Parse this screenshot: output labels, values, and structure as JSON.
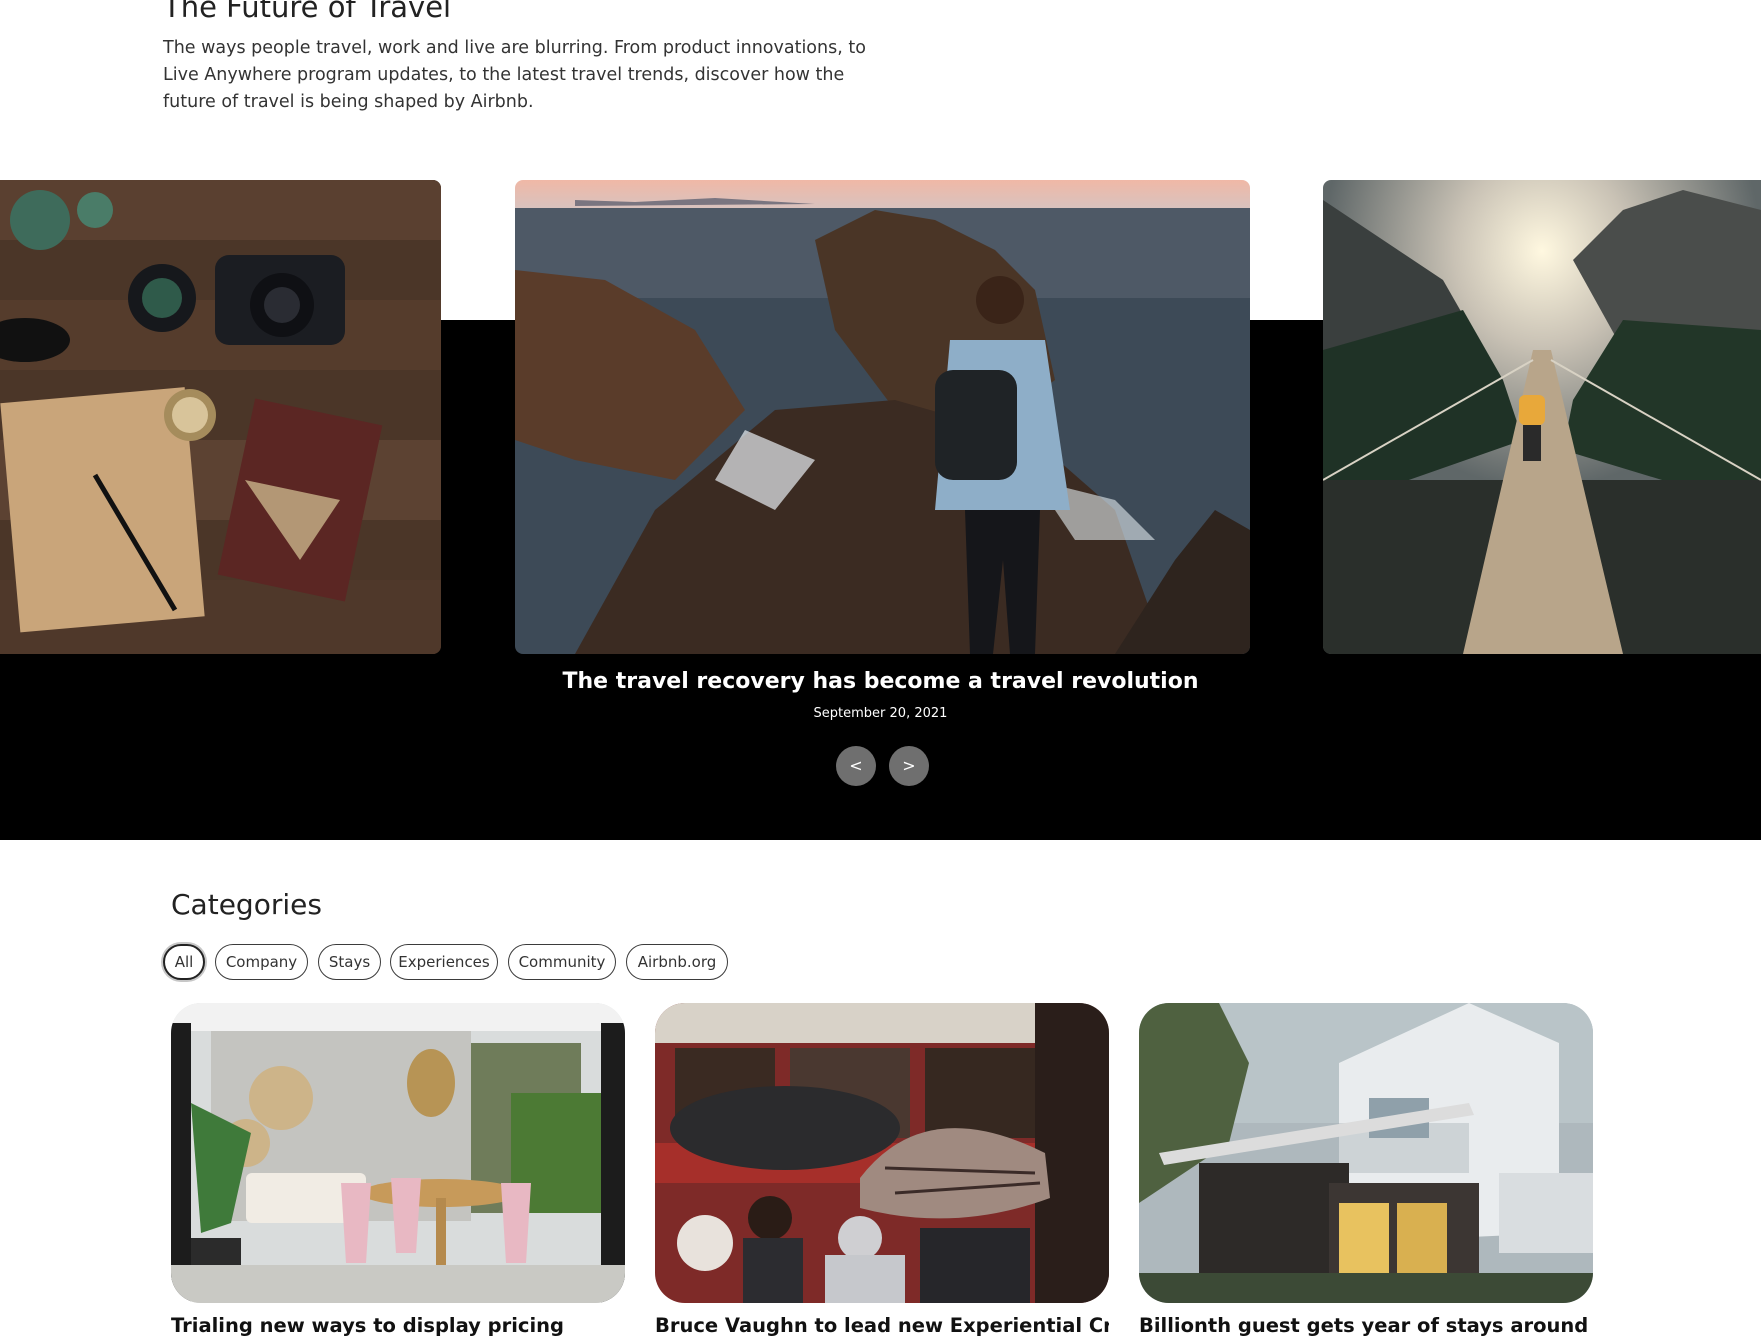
{
  "intro": {
    "title": "The Future of Travel",
    "description": "The ways people travel, work and live are blurring. From product innovations, to Live Anywhere program updates, to the latest travel trends, discover how the future of travel is being shaped by Airbnb."
  },
  "carousel": {
    "slides": [
      {
        "image": "travel-flatlay-camera-compass-photo"
      },
      {
        "image": "hiker-on-sea-cliffs-photo"
      },
      {
        "image": "suspension-bridge-mountains-photo"
      }
    ],
    "active_title": "The travel recovery has become a travel revolution",
    "active_date": "September 20, 2021",
    "prev_label": "<",
    "next_label": ">"
  },
  "categories": {
    "heading": "Categories",
    "chips": [
      "All",
      "Company",
      "Stays",
      "Experiences",
      "Community",
      "Airbnb.org"
    ],
    "active_chip": "All",
    "cards": [
      {
        "image": "outdoor-patio-dining-photo",
        "title": "Trialing new ways to display pricing"
      },
      {
        "image": "people-with-umbrellas-tram-photo",
        "title": "Bruce Vaughn to lead new Experiential Creative"
      },
      {
        "image": "modern-house-pergola-photo",
        "title": "Billionth guest gets year of stays around the"
      }
    ]
  },
  "colors": {
    "band": "#000000",
    "nav_button": "#6f6f6f",
    "text": "#222222"
  }
}
